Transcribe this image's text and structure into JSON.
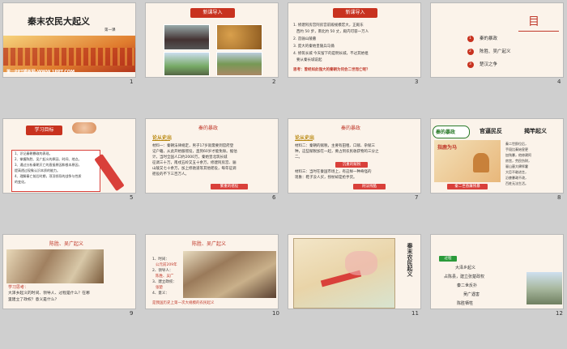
{
  "slides": [
    {
      "num": "1",
      "title": "秦末农民大起义",
      "subtitle": "第一课",
      "footer": "第一PPT模板网-WWW.1PPT.COM"
    },
    {
      "num": "2",
      "header": "新课导入"
    },
    {
      "num": "3",
      "header": "新课导入",
      "lines": [
        "1. 修建阿房宫阿房宫前殿规模宏大，正殿东",
        "西约 50 步，南北约 50 丈，殿内可容一万人",
        "2. 造骊山陵墓",
        "3. 庞大的秦始皇陵兵马俑",
        "4. 修筑长城 今天留下的是明长城，不过其始祖",
        "要从秦长城说起"
      ],
      "question": "思考：曾经如此强大的秦朝为何会二世而亡呢？"
    },
    {
      "num": "4",
      "mark": "目",
      "items": [
        {
          "n": "1",
          "t": "秦的暴政"
        },
        {
          "n": "2",
          "t": "陈胜、吴广起义"
        },
        {
          "n": "3",
          "t": "楚汉之争"
        }
      ]
    },
    {
      "num": "5",
      "header": "学习目标",
      "lines": [
        "1、识记秦朝暴政的表现。",
        "2、掌握陈胜、吴广起义的原因、时间、地点。",
        "3、通过分析秦朝灭亡的直接原因和根本原因，",
        "提高透过现象认识本质的能力。",
        "4、理解秦亡前后时期，项羽领导的战争与性质",
        "的变化。"
      ]
    },
    {
      "num": "6",
      "title": "秦的暴政",
      "label": "论从史出",
      "body": [
        "材料一：秦朝法律规定，男子17岁就需要到官府登",
        "记户籍，从此开始服徭役，直到60岁才能免除。据估",
        "计，当时全国人口约2000万，秦始皇北筑长城",
        "征调三十万，南戍五岭又五十余万，修建阿房宫、骊",
        "山陵又七十余万，加上修驰道等其他徭役，每年征调",
        "徭役的不下三百万人。"
      ],
      "tag": "繁重的徭役"
    },
    {
      "num": "7",
      "title": "秦的暴政",
      "label": "论从史出",
      "body": [
        "材料二：秦朝的赋税，主要有田租、口赋、杂赋三",
        "种，这些赋税加在一起，要占到农民收获物的三分之",
        "二。",
        "材料三：当时在秦国市场上，有这样一种奇怪的",
        "现象：鞋子没人买，拐杖却是抢手货。"
      ],
      "tags": [
        "沉重的赋税",
        "刑法残酷"
      ]
    },
    {
      "num": "8",
      "title1": "秦的暴政",
      "title2": "官逼民反",
      "title3": "揭竿起义",
      "img": "指鹿为马",
      "caption": "秦二世昏庸残暴",
      "side": [
        "秦二世即位后，",
        "手段比秦始皇更",
        "加残暴，他修建阿",
        "房宫，劳民伤财，",
        "骊山墓大肆挥霍",
        "大臣不敢进言，",
        "沿袭暴政不改，",
        "百姓无法生活。"
      ]
    },
    {
      "num": "9",
      "title": "陈胜、吴广起义",
      "think": "学习思考：",
      "q": [
        "大泽乡起义的时间、领导人、过程是什么？在哪",
        "里建立了政权？意义是什么？"
      ]
    },
    {
      "num": "10",
      "title": "陈胜、吴广起义",
      "items": [
        "1、时间：",
        "公元前209年",
        "2、领导人：",
        "陈胜、吴广",
        "3、建立政权：",
        "张楚",
        "4、意义："
      ],
      "footer": "是我国历史上第一次大规模的农民起义"
    },
    {
      "num": "11",
      "vertical": "秦末农民起义"
    },
    {
      "num": "12",
      "process": "过程",
      "steps": [
        "大泽乡起义",
        "占陈县，建立张楚政权",
        "秦二世反扑",
        "吴广遇害",
        "陈胜牺牲"
      ]
    }
  ]
}
